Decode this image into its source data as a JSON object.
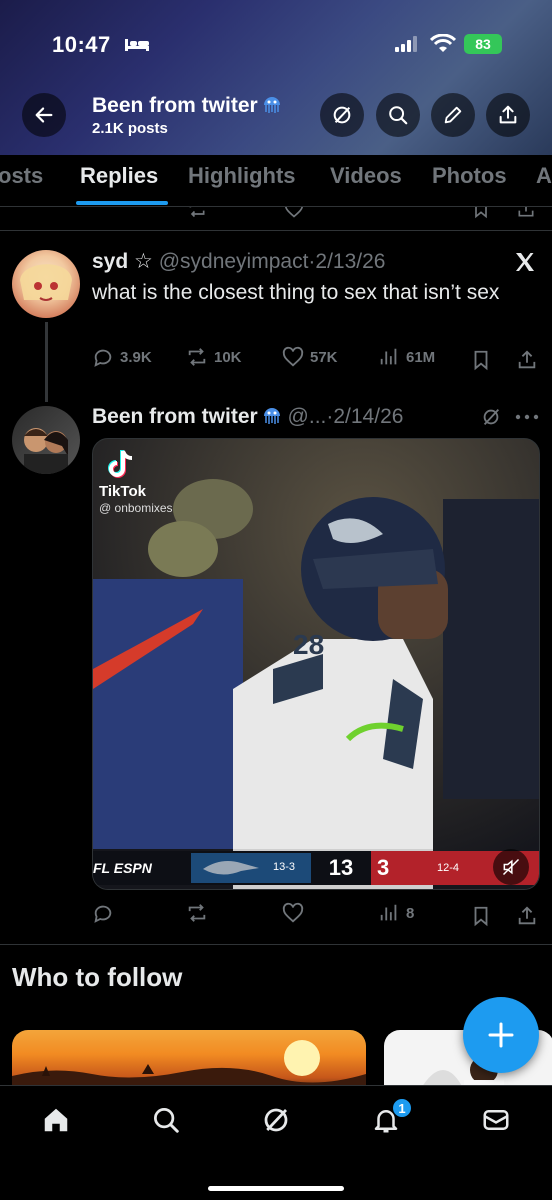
{
  "status_bar": {
    "time": "10:47",
    "battery": "83"
  },
  "header": {
    "title": "Been from twiter",
    "subtitle": "2.1K posts",
    "icons": [
      "back-arrow-icon",
      "grok-icon",
      "search-icon",
      "edit-icon",
      "share-icon"
    ]
  },
  "tabs": [
    {
      "label": "osts",
      "active": false
    },
    {
      "label": "Replies",
      "active": true
    },
    {
      "label": "Highlights",
      "active": false
    },
    {
      "label": "Videos",
      "active": false
    },
    {
      "label": "Photos",
      "active": false
    },
    {
      "label": "A",
      "active": false
    }
  ],
  "tweets": [
    {
      "name": "syd ☆",
      "handle": "@sydneyimpact",
      "date": "·2/13/26",
      "text": "what is the closest thing to sex that isn’t sex",
      "replies": "3.9K",
      "reposts": "10K",
      "likes": "57K",
      "views": "61M",
      "badge_icon": "x-logo-icon"
    },
    {
      "name": "Been from twiter",
      "handle": "@...",
      "date": "·2/14/26",
      "views": "8",
      "media": {
        "watermark_brand": "TikTok",
        "watermark_user": "@ onbomixes",
        "scorebug": {
          "network": "FL ESPN",
          "away_record": "13-3",
          "away_score": "13",
          "home_score": "3",
          "home_record": "12-4",
          "jersey_number": "28"
        }
      }
    }
  ],
  "who_to_follow": {
    "title": "Who to follow"
  },
  "bottom_nav": {
    "items": [
      "home-icon",
      "search-icon",
      "grok-icon",
      "notifications-icon",
      "messages-icon"
    ],
    "notification_count": "1"
  },
  "colors": {
    "accent": "#1d9bf0",
    "background": "#000000",
    "muted": "#71767b"
  }
}
